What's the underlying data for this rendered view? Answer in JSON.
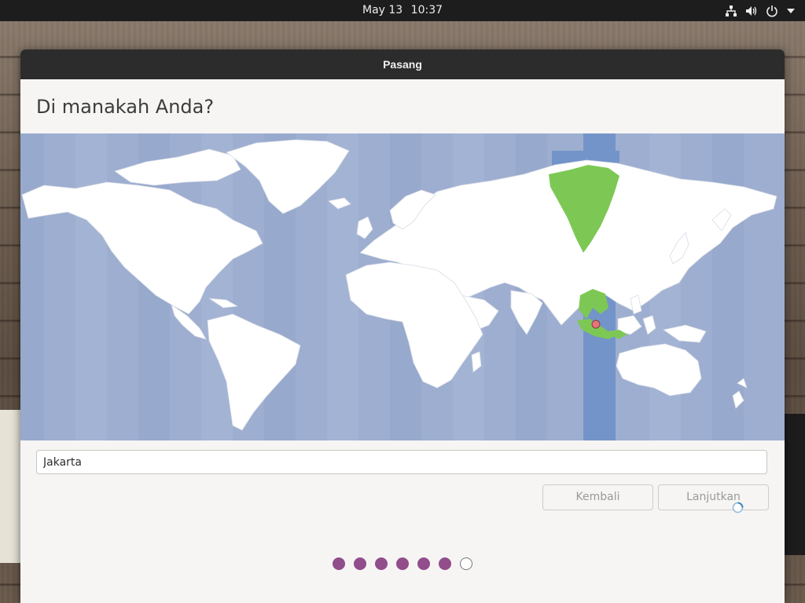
{
  "topbar": {
    "date": "May 13",
    "time": "10:37",
    "icons": [
      "network-icon",
      "volume-icon",
      "power-icon",
      "menu-arrow-icon"
    ]
  },
  "window": {
    "title": "Pasang"
  },
  "page": {
    "heading": "Di manakah Anda?"
  },
  "map": {
    "selected_timezone_highlight_color": "#7dc854",
    "selected_band_color": "#7394c8",
    "ocean_color": "#9daed0",
    "land_color": "#ffffff",
    "pin_color": "#e8747a"
  },
  "location": {
    "value": "Jakarta"
  },
  "buttons": {
    "back": "Kembali",
    "next": "Lanjutkan"
  },
  "progress": {
    "total_steps": 7,
    "completed_steps": 6
  },
  "colors": {
    "accent": "#924d8b",
    "titlebar": "#2c2c2c"
  }
}
